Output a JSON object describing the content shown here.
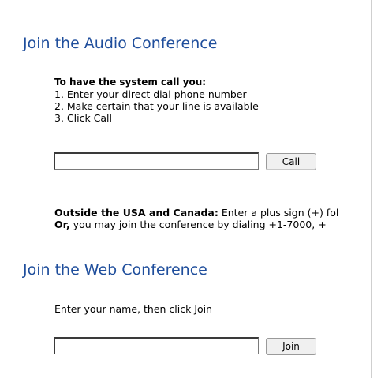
{
  "audio": {
    "title": "Join the Audio Conference",
    "instructions_heading": "To have the system call you:",
    "steps": [
      "1. Enter your direct dial phone number",
      "2. Make certain that your line is available",
      "3. Click Call"
    ],
    "phone_value": "",
    "call_label": "Call",
    "intl_bold": "Outside the USA and Canada:",
    "intl_text": " Enter a plus sign (+) fol",
    "or_bold": "Or,",
    "or_text": " you may join the conference by dialing +1-7000, +"
  },
  "web": {
    "title": "Join the Web Conference",
    "instruction": "Enter your name, then click Join",
    "name_value": "",
    "join_label": "Join"
  }
}
